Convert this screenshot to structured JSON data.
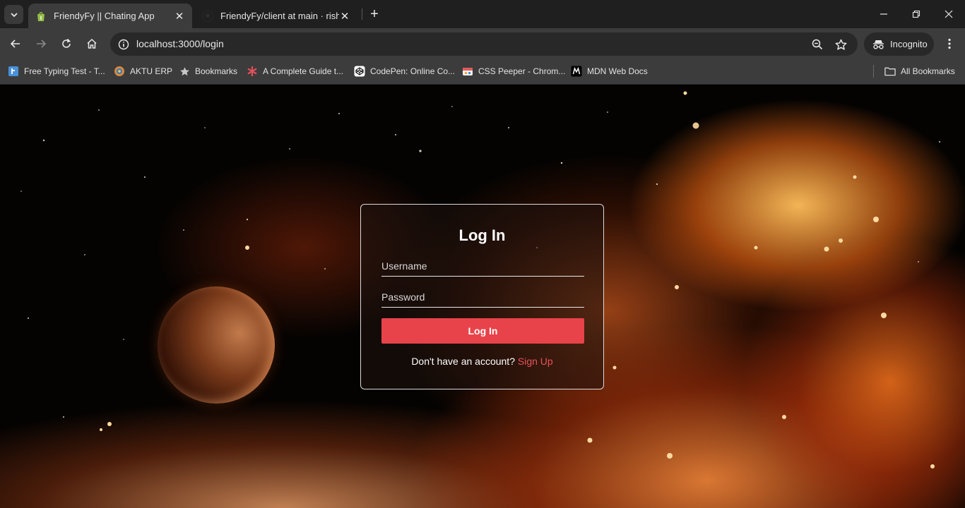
{
  "browser": {
    "tabs": [
      {
        "title": "FriendyFy || Chating App",
        "active": true,
        "favicon": "shopify-bag-icon"
      },
      {
        "title": "FriendyFy/client at main · rishira",
        "active": false,
        "favicon": "github-icon"
      }
    ],
    "url": "localhost:3000/login",
    "incognito_label": "Incognito",
    "bookmarks": [
      {
        "label": "Free Typing Test - T...",
        "icon": "typing-test-icon"
      },
      {
        "label": "AKTU ERP",
        "icon": "aktu-icon"
      },
      {
        "label": "Bookmarks",
        "icon": "star-icon"
      },
      {
        "label": "A Complete Guide t...",
        "icon": "asterisk-icon"
      },
      {
        "label": "CodePen: Online Co...",
        "icon": "codepen-icon"
      },
      {
        "label": "CSS Peeper - Chrom...",
        "icon": "css-peeper-icon"
      },
      {
        "label": "MDN Web Docs",
        "icon": "mdn-icon"
      }
    ],
    "all_bookmarks_label": "All Bookmarks"
  },
  "login": {
    "title": "Log In",
    "username_placeholder": "Username",
    "password_placeholder": "Password",
    "submit_label": "Log In",
    "signup_prompt": "Don't have an account?",
    "signup_link": "Sign Up"
  },
  "colors": {
    "accent": "#e8434a",
    "link": "#e9515a",
    "chrome_bg": "#3c3c3c"
  }
}
